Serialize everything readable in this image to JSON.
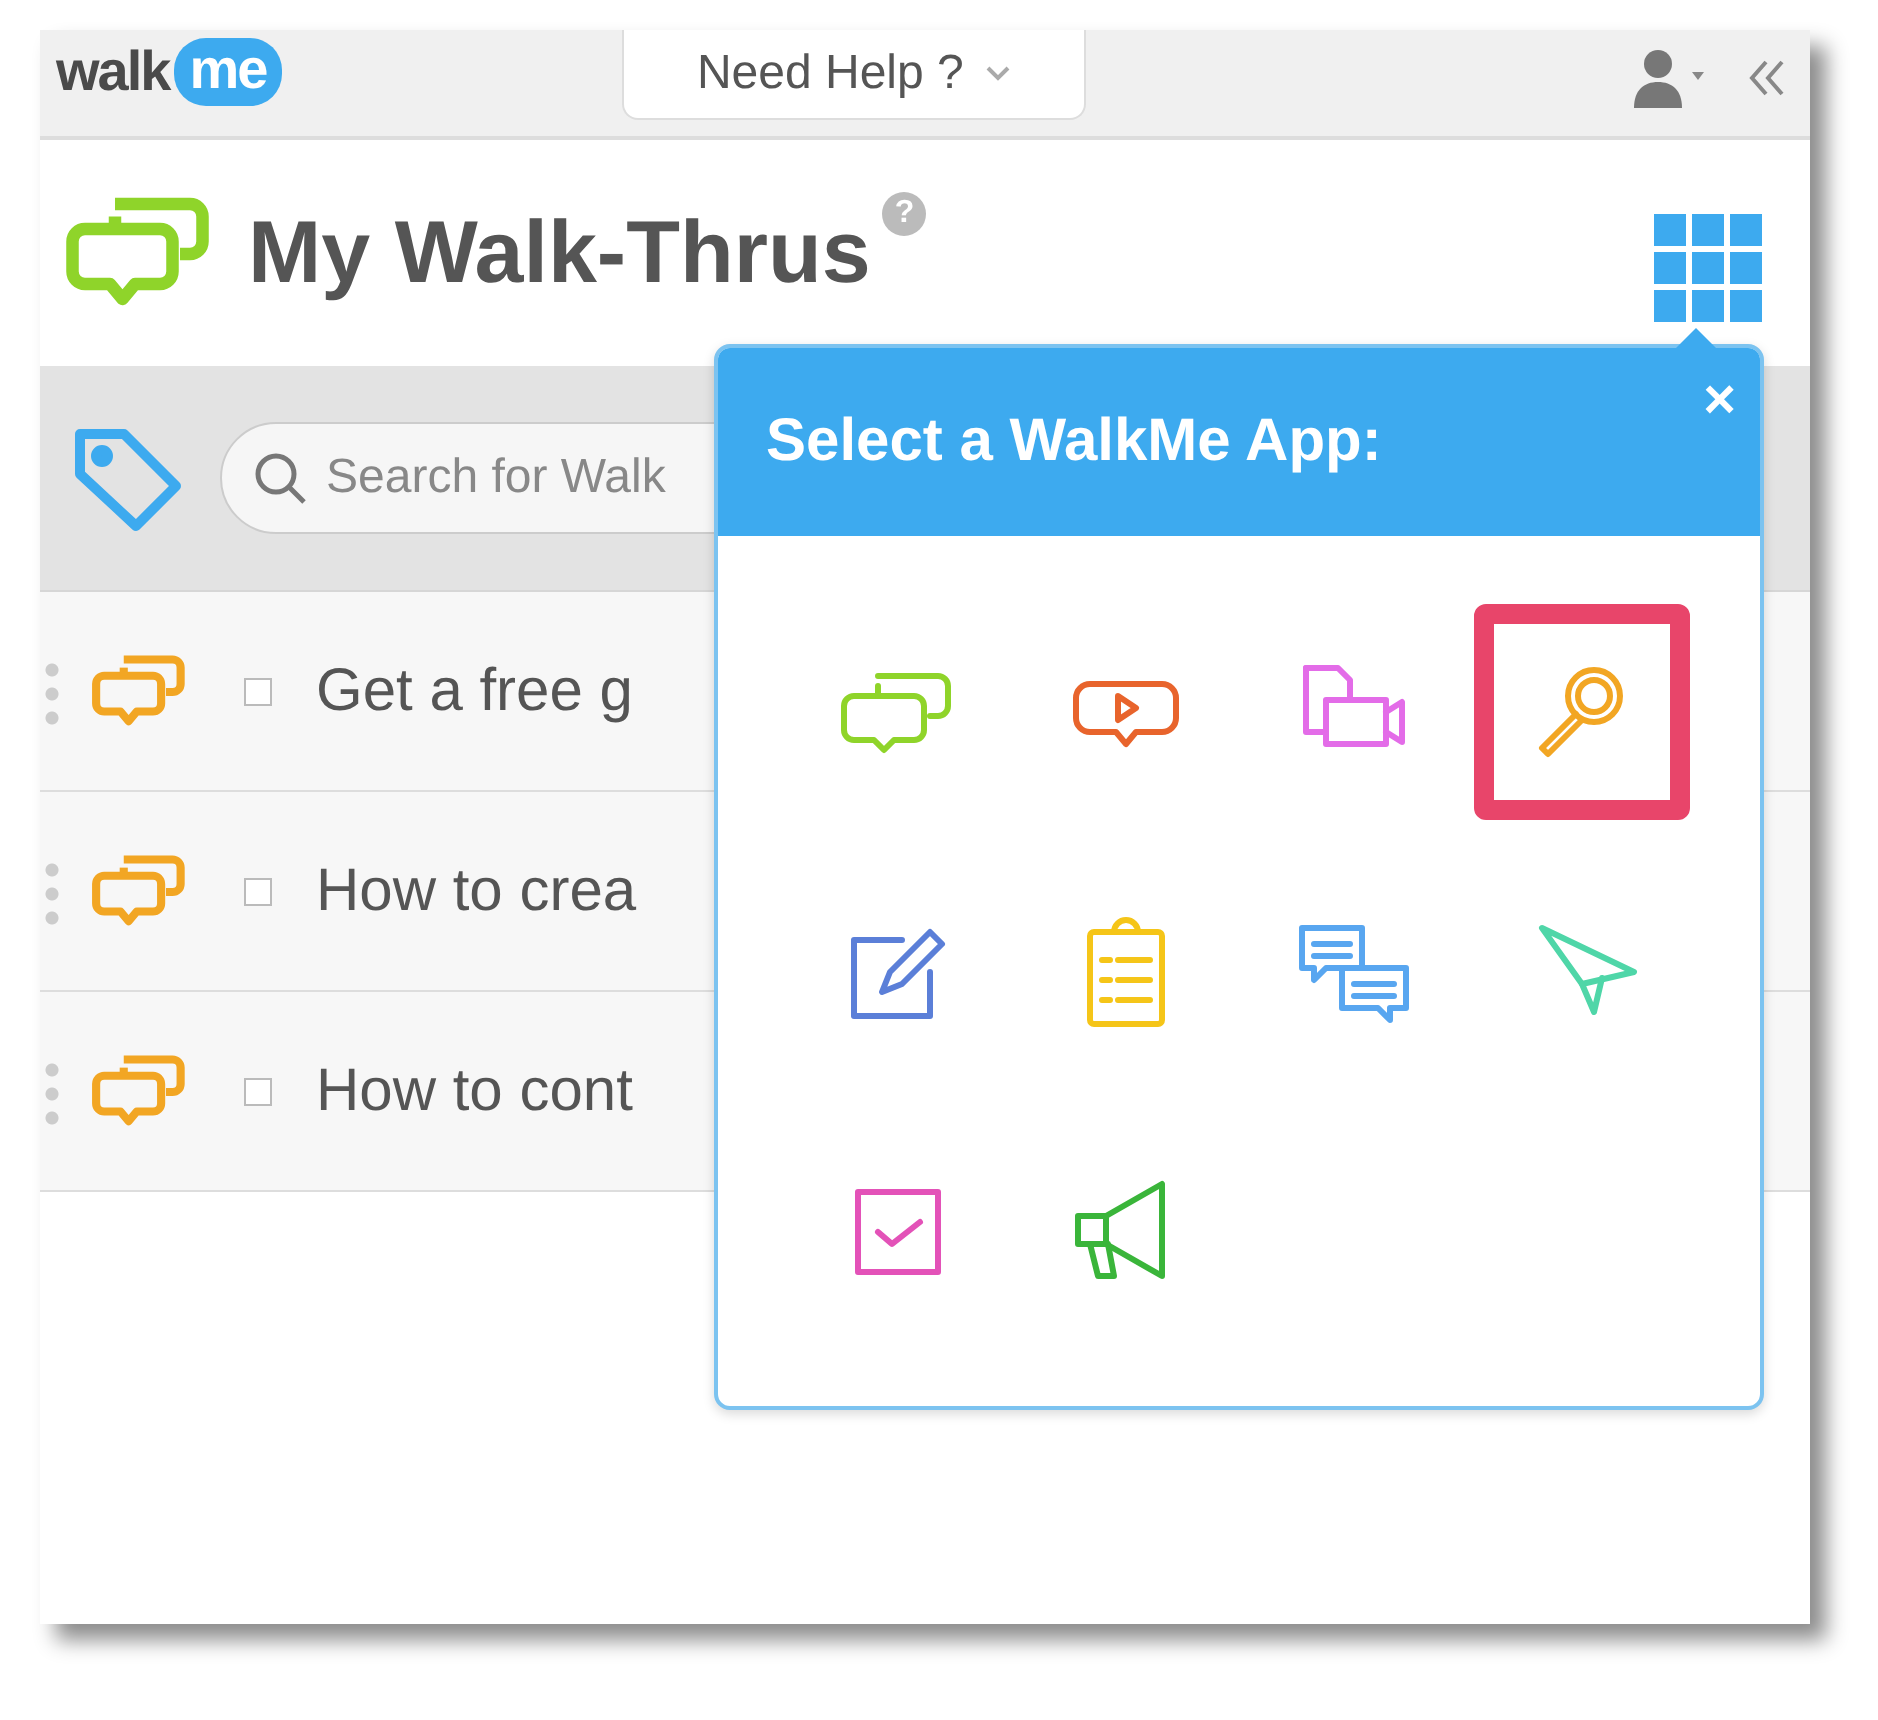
{
  "top_bar": {
    "logo": {
      "text": "walk",
      "badge": "me"
    },
    "help_button": {
      "label": "Need Help ?"
    }
  },
  "header": {
    "title": "My Walk-Thrus",
    "help_badge": "?"
  },
  "search": {
    "placeholder": "Search for Walk"
  },
  "rows": [
    {
      "title": "Get a free g",
      "checked": false
    },
    {
      "title": "How to crea",
      "checked": false
    },
    {
      "title": "How to cont",
      "checked": false
    }
  ],
  "app_picker": {
    "title": "Select a WalkMe App:",
    "close": "×",
    "apps": [
      {
        "kind": "chat",
        "color": "#8fd42a",
        "selected": false
      },
      {
        "kind": "video",
        "color": "#e8642c",
        "selected": false
      },
      {
        "kind": "recorder",
        "color": "#e36ce8",
        "selected": false
      },
      {
        "kind": "search",
        "color": "#f2a623",
        "selected": true
      },
      {
        "kind": "edit",
        "color": "#5b7fd8",
        "selected": false
      },
      {
        "kind": "checklist",
        "color": "#f5c518",
        "selected": false
      },
      {
        "kind": "messages",
        "color": "#58a6f0",
        "selected": false
      },
      {
        "kind": "send",
        "color": "#4fd6a8",
        "selected": false
      },
      {
        "kind": "checkbox",
        "color": "#e352b8",
        "selected": false
      },
      {
        "kind": "megaphone",
        "color": "#3ab53a",
        "selected": false
      }
    ]
  }
}
